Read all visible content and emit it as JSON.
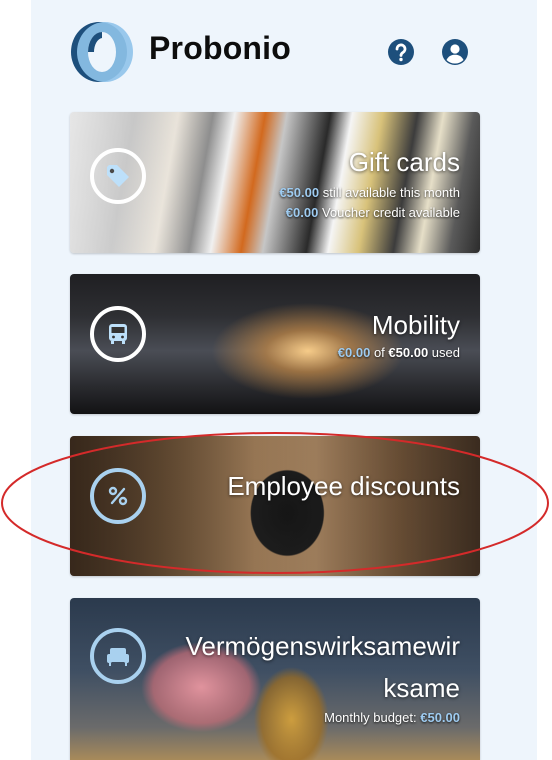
{
  "header": {
    "brand": "Probonio",
    "logo_icon": "probonio-logo",
    "help_icon": "help-circle-icon",
    "account_icon": "account-circle-icon"
  },
  "colors": {
    "brand_blue": "#1d4f7c",
    "light_blue": "#a9d1ef",
    "amount_blue": "#9ecbf0",
    "highlight_red": "#d42a2a"
  },
  "cards": {
    "gift": {
      "title": "Gift cards",
      "icon": "tag-icon",
      "line1_amount": "€50.00",
      "line1_text": " still available this month",
      "line2_amount": "€0.00",
      "line2_text": " Voucher credit available"
    },
    "mobility": {
      "title": "Mobility",
      "icon": "bus-icon",
      "used_amount": "€0.00",
      "of_text": " of ",
      "total_amount": "€50.00",
      "used_text": " used"
    },
    "discounts": {
      "title": "Employee discounts",
      "icon": "percent-icon"
    },
    "vwl": {
      "title_line1": "Vermögenswirksamewir",
      "title_line2": "ksame",
      "icon": "sofa-icon",
      "budget_label": "Monthly budget: ",
      "budget_amount": "€50.00"
    }
  }
}
